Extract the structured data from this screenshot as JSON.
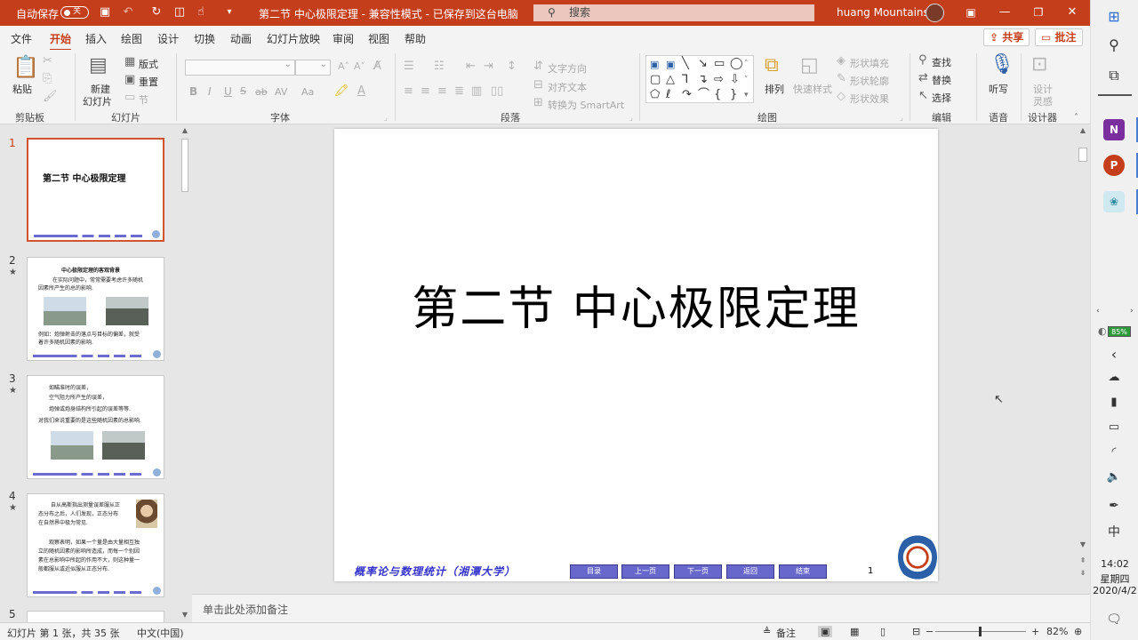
{
  "titlebar": {
    "autosave_label": "自动保存",
    "autosave_state": "关",
    "doc_title": "第二节  中心极限定理  -  兼容性模式  -  已保存到这台电脑",
    "search_placeholder": "搜索",
    "user_name": "huang Mountains"
  },
  "menu": {
    "tabs": [
      "文件",
      "开始",
      "插入",
      "绘图",
      "设计",
      "切换",
      "动画",
      "幻灯片放映",
      "审阅",
      "视图",
      "帮助"
    ],
    "share": "共享",
    "comment": "批注"
  },
  "ribbon": {
    "clipboard": {
      "label": "剪贴板",
      "paste": "粘贴"
    },
    "slides": {
      "label": "幻灯片",
      "new_slide_1": "新建",
      "new_slide_2": "幻灯片",
      "layout": "版式",
      "reset": "重置",
      "section": "节"
    },
    "font": {
      "label": "字体",
      "bold": "B",
      "italic": "I",
      "underline": "U",
      "strike": "ab",
      "spacing": "AV",
      "case": "Aa"
    },
    "paragraph": {
      "label": "段落",
      "text_direction": "文字方向",
      "align_text": "对齐文本",
      "smartart": "转换为 SmartArt"
    },
    "drawing": {
      "label": "绘图",
      "arrange": "排列",
      "quick_styles": "快速样式",
      "fill": "形状填充",
      "outline": "形状轮廓",
      "effects": "形状效果"
    },
    "editing": {
      "label": "编辑",
      "find": "查找",
      "replace": "替换",
      "select": "选择"
    },
    "voice": {
      "label": "语音",
      "dictate": "听写"
    },
    "designer": {
      "label": "设计器",
      "ideas_1": "设计",
      "ideas_2": "灵感"
    }
  },
  "thumbnails": [
    {
      "num": "1",
      "title": "第二节   中心极限定理"
    },
    {
      "num": "2",
      "lines": [
        "中心极限定理的客观背景",
        "在实际问题中，常常需要考虑许多随机",
        "因素所产生的总的影响.",
        "例如：炮弹射击的落点与目标的偏差，就受",
        "着许多随机因素的影响."
      ]
    },
    {
      "num": "3",
      "lines": [
        "如瞄准时的误差，",
        "空气阻力所产生的误差，",
        "炮弹或炮身结构所引起的误差等等.",
        "对我们来说重要的是这些随机因素的总影响."
      ]
    },
    {
      "num": "4",
      "lines": [
        "自从高斯指出测量误差服从正",
        "态分布之后，人们发现，正态分布",
        "在自然界中极为常见.",
        "观察表明，如果一个量是由大量相互独",
        "立的随机因素的影响所造成，而每一个别因",
        "素在总影响中所起的作用不大，则这种量一",
        "般都服从或近似服从正态分布."
      ]
    },
    {
      "num": "5"
    }
  ],
  "slide": {
    "title": "第二节   中心极限定理",
    "course": "概率论与数理统计（湘潭大学）",
    "nav": [
      "目录",
      "上一页",
      "下一页",
      "返回",
      "结束"
    ],
    "page_number": "1"
  },
  "notes_placeholder": "单击此处添加备注",
  "status": {
    "slide_info": "幻灯片 第 1 张，共 35 张",
    "language": "中文(中国)",
    "notes": "备注",
    "zoom": "82%"
  },
  "taskbar": {
    "battery": "85%",
    "ime": "中",
    "time": "14:02",
    "weekday": "星期四",
    "date": "2020/4/2"
  },
  "colors": {
    "accent": "#c43e1c",
    "nav_button": "#6868cc",
    "course_text": "#3333cc"
  }
}
